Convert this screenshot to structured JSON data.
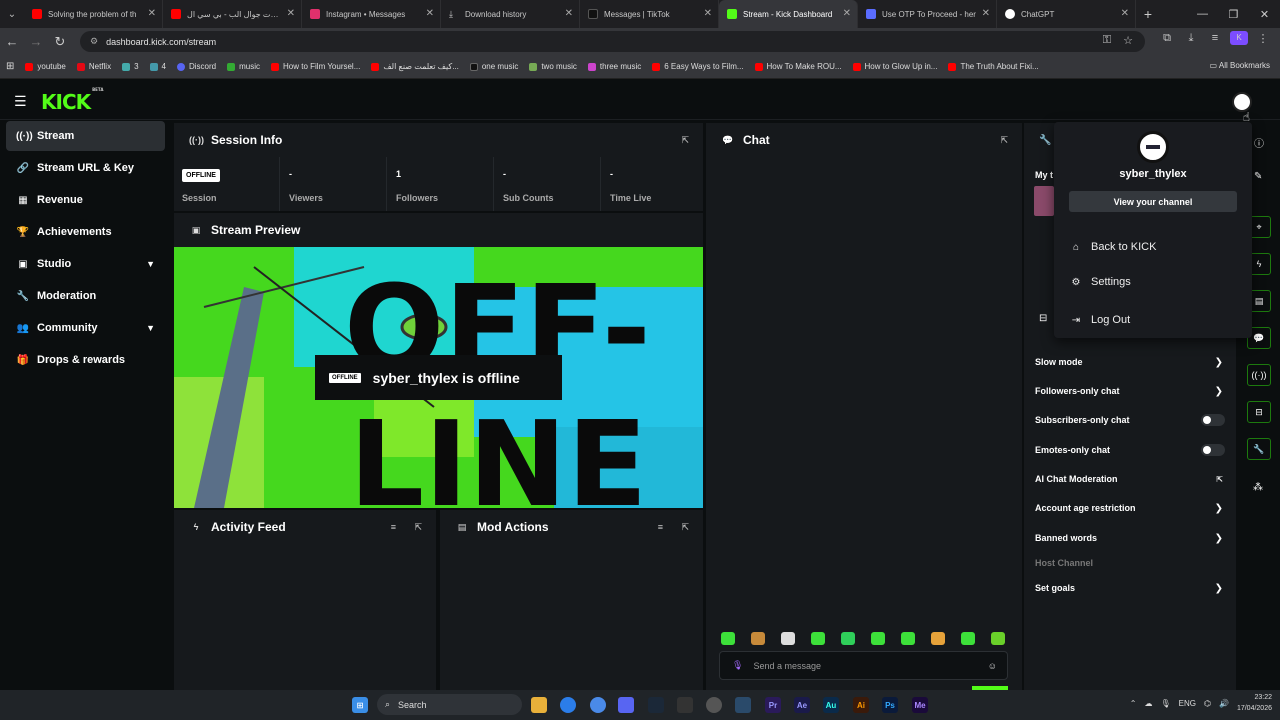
{
  "browser": {
    "tabs": [
      {
        "title": "Solving the problem of th",
        "color": "#ff0000"
      },
      {
        "title": "جولات جوال الب - بي سي ال",
        "color": "#ff0000"
      },
      {
        "title": "Instagram • Messages",
        "color": "#e1306c"
      },
      {
        "title": "Download history",
        "color": "#bbbbbb"
      },
      {
        "title": "Messages | TikTok",
        "color": "#111111"
      },
      {
        "title": "Stream - Kick Dashboard",
        "color": "#53fc18"
      },
      {
        "title": "Use OTP To Proceed - her",
        "color": "#5a6cff"
      },
      {
        "title": "ChatGPT",
        "color": "#ffffff"
      }
    ],
    "url": "dashboard.kick.com/stream",
    "bookmarks": [
      {
        "label": "youtube",
        "color": "#ff0000"
      },
      {
        "label": "Netflix",
        "color": "#e50914"
      },
      {
        "label": "3",
        "color": "#4aa"
      },
      {
        "label": "4",
        "color": "#49a"
      },
      {
        "label": "Discord",
        "color": "#5865f2"
      },
      {
        "label": "music",
        "color": "#3a3"
      },
      {
        "label": "How to Film Yoursel...",
        "color": "#ff0000"
      },
      {
        "label": "كيف تعلمت صنع الف...",
        "color": "#ff0000"
      },
      {
        "label": "one music",
        "color": "#111"
      },
      {
        "label": "two music",
        "color": "#7a5"
      },
      {
        "label": "three music",
        "color": "#c4c"
      },
      {
        "label": "6 Easy Ways to Film...",
        "color": "#ff0000"
      },
      {
        "label": "How To Make ROU...",
        "color": "#ff0000"
      },
      {
        "label": "How to Glow Up in...",
        "color": "#ff0000"
      },
      {
        "label": "The Truth About Fixi...",
        "color": "#ff0000"
      }
    ],
    "all_bookmarks": "All Bookmarks"
  },
  "app": {
    "logo": "KICK",
    "logo_badge": "BETA"
  },
  "sidebar": {
    "items": [
      {
        "label": "Stream",
        "icon": "broadcast-icon"
      },
      {
        "label": "Stream URL & Key",
        "icon": "link-icon"
      },
      {
        "label": "Revenue",
        "icon": "chart-icon"
      },
      {
        "label": "Achievements",
        "icon": "trophy-icon"
      },
      {
        "label": "Studio",
        "icon": "studio-icon"
      },
      {
        "label": "Moderation",
        "icon": "wrench-icon"
      },
      {
        "label": "Community",
        "icon": "community-icon"
      },
      {
        "label": "Drops & rewards",
        "icon": "gift-icon"
      }
    ]
  },
  "session": {
    "title": "Session Info",
    "status_badge": "OFFLINE",
    "stats": [
      {
        "value": "",
        "label": "Session"
      },
      {
        "value": "-",
        "label": "Viewers"
      },
      {
        "value": "1",
        "label": "Followers"
      },
      {
        "value": "-",
        "label": "Sub Counts"
      },
      {
        "value": "-",
        "label": "Time Live"
      }
    ]
  },
  "preview": {
    "title": "Stream Preview",
    "offline_badge": "OFFLINE",
    "offline_text": "syber_thylex is offline",
    "art_text_1": "OFF-",
    "art_text_2": "LINE"
  },
  "activity": {
    "title": "Activity Feed"
  },
  "modactions": {
    "title": "Mod Actions"
  },
  "chat": {
    "title": "Chat",
    "placeholder": "Send a message"
  },
  "mod_panel": {
    "partial_label": "My t",
    "items": [
      {
        "label": "Slow mode",
        "control": "chevron"
      },
      {
        "label": "Followers-only chat",
        "control": "chevron"
      },
      {
        "label": "Subscribers-only chat",
        "control": "toggle"
      },
      {
        "label": "Emotes-only chat",
        "control": "toggle"
      },
      {
        "label": "AI Chat Moderation",
        "control": "external"
      },
      {
        "label": "Account age restriction",
        "control": "chevron"
      },
      {
        "label": "Banned words",
        "control": "chevron"
      },
      {
        "label": "Host Channel",
        "control": "none"
      },
      {
        "label": "Set goals",
        "control": "chevron"
      }
    ]
  },
  "dropdown": {
    "username": "syber_thylex",
    "view_channel": "View your channel",
    "items": [
      {
        "label": "Back to KICK",
        "icon": "home-icon"
      },
      {
        "label": "Settings",
        "icon": "gear-icon"
      },
      {
        "label": "Log Out",
        "icon": "logout-icon"
      }
    ]
  },
  "taskbar": {
    "search": "Search",
    "lang": "ENG",
    "time": "23:22",
    "date": "17/04/2026"
  },
  "colors": {
    "accent": "#53fc18",
    "panel": "#16191c",
    "bg": "#0b0e0f"
  }
}
